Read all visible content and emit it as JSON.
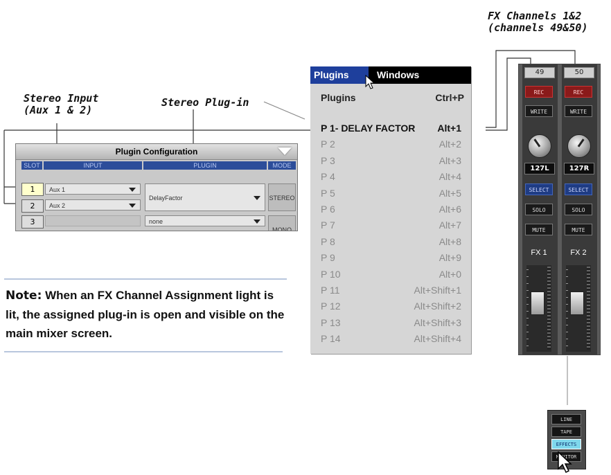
{
  "callouts": {
    "fx_channels": "FX Channels 1&2\n(channels 49&50)",
    "stereo_input": "Stereo Input\n(Aux 1 & 2)",
    "stereo_plugin": "Stereo Plug-in"
  },
  "plugin_config": {
    "title": "Plugin Configuration",
    "headers": {
      "slot": "SLOT",
      "input": "INPUT",
      "plugin": "PLUGIN",
      "mode": "MODE"
    },
    "rows": [
      {
        "slot": "1",
        "input": "Aux 1"
      },
      {
        "slot": "2",
        "input": "Aux 2"
      },
      {
        "slot": "3",
        "input": ""
      }
    ],
    "plugin_1": "DelayFactor",
    "plugin_3": "none",
    "mode_1": "STEREO",
    "mode_3": "MONO"
  },
  "note": {
    "label": "Note:",
    "text": " When an FX Channel Assignment light is lit, the assigned plug-in is open and visible on the main mixer screen."
  },
  "menu": {
    "menubar": {
      "plugins": "Plugins",
      "windows": "Windows"
    },
    "submenu": {
      "label": "Plugins",
      "shortcut": "Ctrl+P"
    },
    "items": [
      {
        "label": "P 1- DELAY FACTOR",
        "shortcut": "Alt+1"
      },
      {
        "label": "P 2",
        "shortcut": "Alt+2"
      },
      {
        "label": "P 3",
        "shortcut": "Alt+3"
      },
      {
        "label": "P 4",
        "shortcut": "Alt+4"
      },
      {
        "label": "P 5",
        "shortcut": "Alt+5"
      },
      {
        "label": "P 6",
        "shortcut": "Alt+6"
      },
      {
        "label": "P 7",
        "shortcut": "Alt+7"
      },
      {
        "label": "P 8",
        "shortcut": "Alt+8"
      },
      {
        "label": "P 9",
        "shortcut": "Alt+9"
      },
      {
        "label": "P 10",
        "shortcut": "Alt+0"
      },
      {
        "label": "P 11",
        "shortcut": "Alt+Shift+1"
      },
      {
        "label": "P 12",
        "shortcut": "Alt+Shift+2"
      },
      {
        "label": "P 13",
        "shortcut": "Alt+Shift+3"
      },
      {
        "label": "P 14",
        "shortcut": "Alt+Shift+4"
      }
    ]
  },
  "strips": [
    {
      "channel": "49",
      "rec": "REC",
      "write": "WRITE",
      "pan": "127L",
      "select": "SELECT",
      "solo": "SOLO",
      "mute": "MUTE",
      "fx": "FX 1"
    },
    {
      "channel": "50",
      "rec": "REC",
      "write": "WRITE",
      "pan": "127R",
      "select": "SELECT",
      "solo": "SOLO",
      "mute": "MUTE",
      "fx": "FX 2"
    }
  ],
  "popup": {
    "items": [
      "LINE",
      "TAPE",
      "EFFECTS",
      "MONITOR"
    ],
    "selected": "EFFECTS"
  },
  "colors": {
    "menu_highlight": "#1e3f9c",
    "rec": "#8a1a1a",
    "select_blue": "#1f3c84",
    "effects_selected": "#7fd8ec"
  }
}
